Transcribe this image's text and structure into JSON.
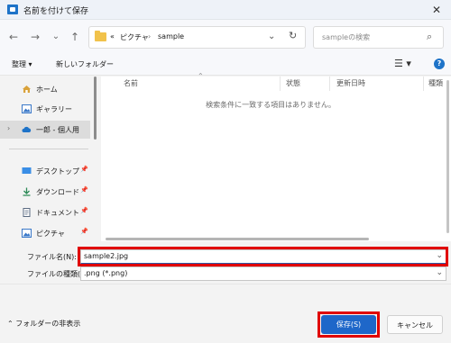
{
  "window": {
    "title": "名前を付けて保存",
    "close_glyph": "✕"
  },
  "nav": {
    "back_glyph": "←",
    "forward_glyph": "→",
    "history_glyph": "⌄",
    "up_glyph": "↑",
    "breadcrumb_prefix": "«",
    "breadcrumb": [
      "ピクチャ",
      "sample"
    ],
    "breadcrumb_sep": "›",
    "search_placeholder": "sampleの検索"
  },
  "toolbar": {
    "organize_label": "整理 ▾",
    "new_folder_label": "新しいフォルダー"
  },
  "sidebar": {
    "items": [
      {
        "label": "ホーム",
        "icon": "home-icon"
      },
      {
        "label": "ギャラリー",
        "icon": "gallery-icon"
      },
      {
        "label": "一郎 - 個人用",
        "icon": "cloud-icon"
      },
      {
        "label": "デスクトップ",
        "icon": "desktop-icon"
      },
      {
        "label": "ダウンロード",
        "icon": "download-icon"
      },
      {
        "label": "ドキュメント",
        "icon": "document-icon"
      },
      {
        "label": "ピクチャ",
        "icon": "picture-icon"
      }
    ]
  },
  "filelist": {
    "columns": [
      "名前",
      "状態",
      "更新日時",
      "種類"
    ],
    "empty_message": "検索条件に一致する項目はありません。"
  },
  "form": {
    "filename_label": "ファイル名(N):",
    "filename_value": "sample2.jpg",
    "filetype_label": "ファイルの種類(T):",
    "filetype_value": ".png (*.png)"
  },
  "footer": {
    "hide_folders_label": "フォルダーの非表示",
    "save_label": "保存(S)",
    "cancel_label": "キャンセル"
  },
  "colors": {
    "accent": "#1e67c9",
    "highlight": "#e00000",
    "folder": "#f1c24b"
  }
}
